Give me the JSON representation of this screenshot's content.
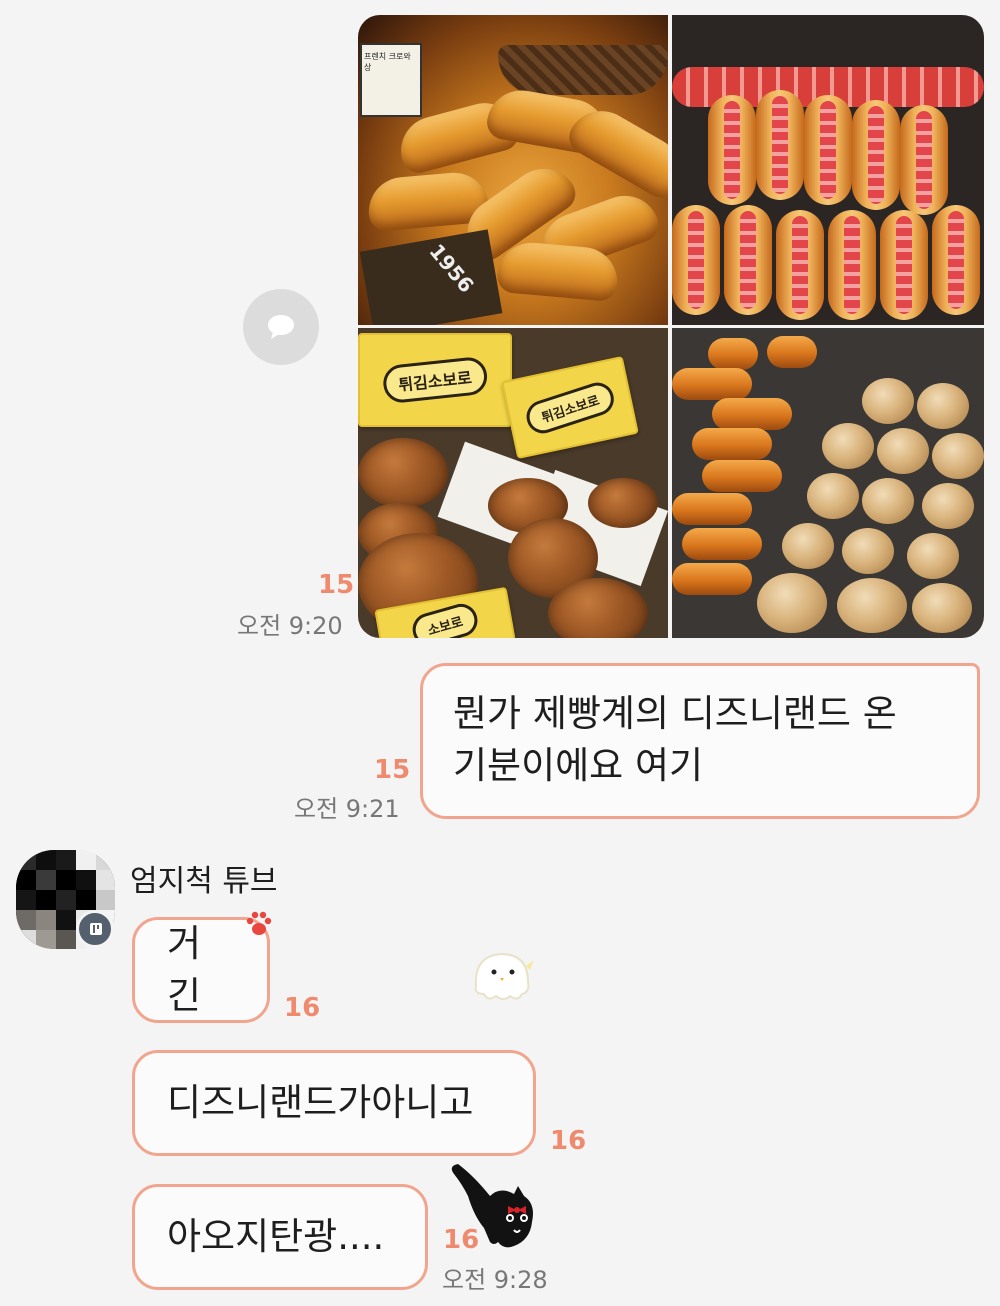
{
  "colors": {
    "bubble_border": "#f2a58e",
    "read_count": "#f08a6e",
    "background": "#f4f4f4",
    "time_text": "#777777"
  },
  "photo_message": {
    "photos": [
      {
        "name": "croissant-photo",
        "tag_text": "프렌치 크로와상",
        "bag_text": "1956"
      },
      {
        "name": "sausage-bun-photo"
      },
      {
        "name": "fried-soboro-photo",
        "bag_label": "튀김소보로",
        "bag_label_2": "튀김소보로",
        "bag_label_3": "소보로"
      },
      {
        "name": "assorted-breads-photo"
      }
    ],
    "share_icon": "speech-bubble-icon",
    "read_count": "15",
    "time": "오전 9:20"
  },
  "my_message": {
    "line1": "뭔가 제빵계의 디즈니랜드 온",
    "line2": "기분이에요 여기",
    "read_count": "15",
    "time": "오전 9:21"
  },
  "sender": {
    "name": "엄지척 튜브",
    "avatar": "pixelated-avatar",
    "badge_icon": "profile-badge-icon"
  },
  "their_messages": [
    {
      "text": "거긴",
      "read_count": "16",
      "sticker": "paw-icon"
    },
    {
      "text": "디즈니랜드가아니고",
      "read_count": "16"
    },
    {
      "text": "아오지탄광....",
      "read_count": "16",
      "time": "오전 9:28",
      "sticker": "black-cat-icon"
    }
  ],
  "floating_sticker": "ghost-chick-icon"
}
